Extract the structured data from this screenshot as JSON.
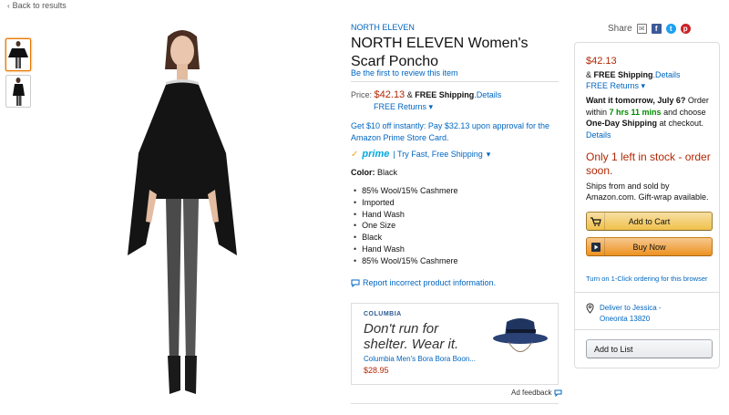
{
  "nav": {
    "back_label": "Back to results"
  },
  "product": {
    "brand": "NORTH ELEVEN",
    "title": "NORTH ELEVEN Women's Scarf Poncho",
    "review_link": "Be the first to review this item",
    "price_label": "Price:",
    "price": "$42.13",
    "shipping_prefix": "& ",
    "shipping_bold": "FREE Shipping",
    "shipping_details": ".Details",
    "free_returns": "FREE Returns",
    "promo": "Get $10 off instantly: Pay $32.13 upon approval for the Amazon Prime Store Card.",
    "prime_logo": "prime",
    "prime_text": "| Try Fast, Free Shipping",
    "color_label": "Color:",
    "color_value": "Black",
    "features": [
      "85% Wool/15% Cashmere",
      "Imported",
      "Hand Wash",
      "One Size",
      "Black",
      "Hand Wash",
      "85% Wool/15% Cashmere"
    ],
    "report_link": "Report incorrect product information."
  },
  "ad": {
    "brand": "COLUMBIA",
    "headline": "Don't run for shelter. Wear it.",
    "product": "Columbia Men's Bora Bora Boon...",
    "price": "$28.95",
    "feedback_label": "Ad feedback"
  },
  "share": {
    "label": "Share"
  },
  "buybox": {
    "price": "$42.13",
    "shipping_prefix": "& ",
    "shipping_bold": "FREE Shipping",
    "shipping_details": ".Details",
    "free_returns": "FREE Returns",
    "want_bold": "Want it tomorrow, July 6?",
    "want_text": " Order within ",
    "want_time": "7 hrs 11 mins",
    "want_text2": " and choose ",
    "want_bold2": "One-Day Shipping",
    "want_text3": " at checkout.",
    "details": "Details",
    "stock": "Only 1 left in stock - order soon.",
    "ships": "Ships from and sold by Amazon.com. Gift-wrap available.",
    "add_to_cart": "Add to Cart",
    "buy_now": "Buy Now",
    "one_click": "Turn on 1-Click ordering for this browser",
    "deliver_line1": "Deliver to Jessica -",
    "deliver_line2": "Oneonta 13820",
    "add_to_list": "Add to List"
  },
  "colors": {
    "link": "#0066c0",
    "price": "#b12704",
    "accent": "#e77600",
    "green": "#008a00"
  }
}
